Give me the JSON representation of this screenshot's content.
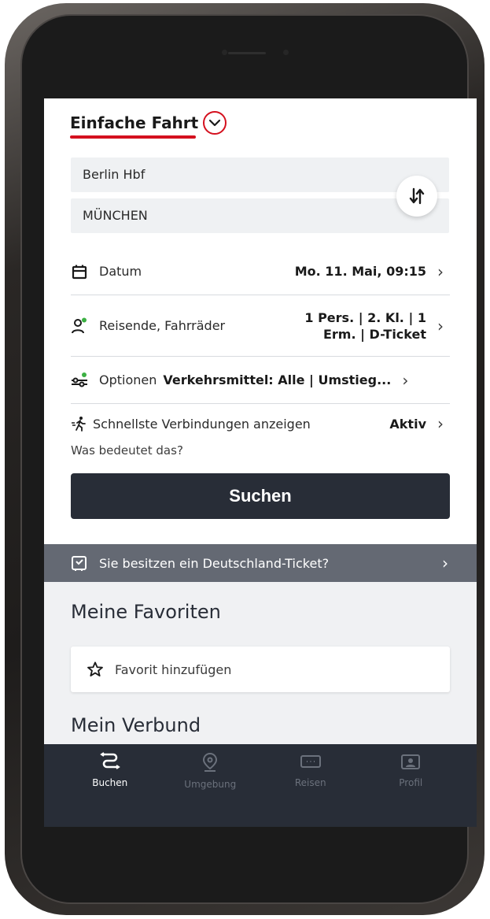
{
  "trip_type": {
    "label": "Einfache Fahrt"
  },
  "stations": {
    "from": "Berlin Hbf",
    "to": "MÜNCHEN"
  },
  "rows": {
    "date": {
      "label": "Datum",
      "value": "Mo. 11. Mai, 09:15"
    },
    "travelers": {
      "label": "Reisende, Fahrräder",
      "value_line1": "1 Pers. | 2. Kl. | 1",
      "value_line2": "Erm. | D-Ticket"
    },
    "options": {
      "label": "Optionen",
      "value": "Verkehrsmittel: Alle | Umstieg..."
    },
    "fastest": {
      "label": "Schnellste Verbindungen anzeigen",
      "value": "Aktiv",
      "note": "Was bedeutet das?"
    }
  },
  "search_button": {
    "label": "Suchen"
  },
  "dticket_banner": {
    "label": "Sie besitzen ein Deutschland-Ticket?"
  },
  "favorites": {
    "title": "Meine Favoriten",
    "add_label": "Favorit hinzufügen"
  },
  "verbund": {
    "title": "Mein Verbund"
  },
  "tabbar": {
    "tabs": [
      {
        "label": "Buchen",
        "icon": "route-icon",
        "active": true
      },
      {
        "label": "Umgebung",
        "icon": "location-pin-icon",
        "active": false
      },
      {
        "label": "Reisen",
        "icon": "ticket-icon",
        "active": false
      },
      {
        "label": "Profil",
        "icon": "profile-card-icon",
        "active": false
      }
    ]
  },
  "colors": {
    "accent": "#d4101e",
    "dark": "#282d37",
    "banner": "#646973",
    "green": "#3cb043"
  }
}
